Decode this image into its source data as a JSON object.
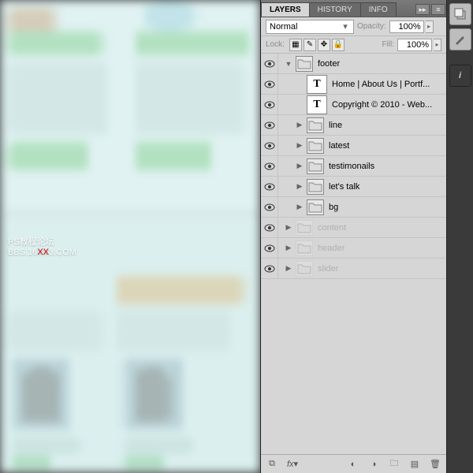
{
  "tabs": {
    "layers": "LAYERS",
    "history": "HISTORY",
    "info": "INFO"
  },
  "blend": {
    "mode": "Normal",
    "opacity_label": "Opacity:",
    "opacity": "100%",
    "fill_label": "Fill:",
    "fill": "100%",
    "lock_label": "Lock:"
  },
  "watermark": {
    "line1": "PS教程论坛",
    "line2a": "BBS.16",
    "line2b": "XX",
    "line2c": "3.COM"
  },
  "layers": [
    {
      "eye": true,
      "depth": 0,
      "expand": "down",
      "kind": "folder",
      "name": "footer",
      "dim": false
    },
    {
      "eye": true,
      "depth": 1,
      "expand": "",
      "kind": "text",
      "name": "Home | About Us | Portf...",
      "dim": false
    },
    {
      "eye": true,
      "depth": 1,
      "expand": "",
      "kind": "text",
      "name": "Copyright © 2010 - Web...",
      "dim": false
    },
    {
      "eye": true,
      "depth": 1,
      "expand": "right",
      "kind": "folder",
      "name": "line",
      "dim": false
    },
    {
      "eye": true,
      "depth": 1,
      "expand": "right",
      "kind": "folder",
      "name": "latest",
      "dim": false
    },
    {
      "eye": true,
      "depth": 1,
      "expand": "right",
      "kind": "folder",
      "name": "testimonails",
      "dim": false
    },
    {
      "eye": true,
      "depth": 1,
      "expand": "right",
      "kind": "folder",
      "name": "let's talk",
      "dim": false
    },
    {
      "eye": true,
      "depth": 1,
      "expand": "right",
      "kind": "folder",
      "name": "bg",
      "dim": false
    },
    {
      "eye": true,
      "depth": 0,
      "expand": "right",
      "kind": "folder",
      "name": "content",
      "dim": true
    },
    {
      "eye": true,
      "depth": 0,
      "expand": "right",
      "kind": "folder",
      "name": "header",
      "dim": true
    },
    {
      "eye": true,
      "depth": 0,
      "expand": "right",
      "kind": "folder",
      "name": "slider",
      "dim": true
    }
  ]
}
